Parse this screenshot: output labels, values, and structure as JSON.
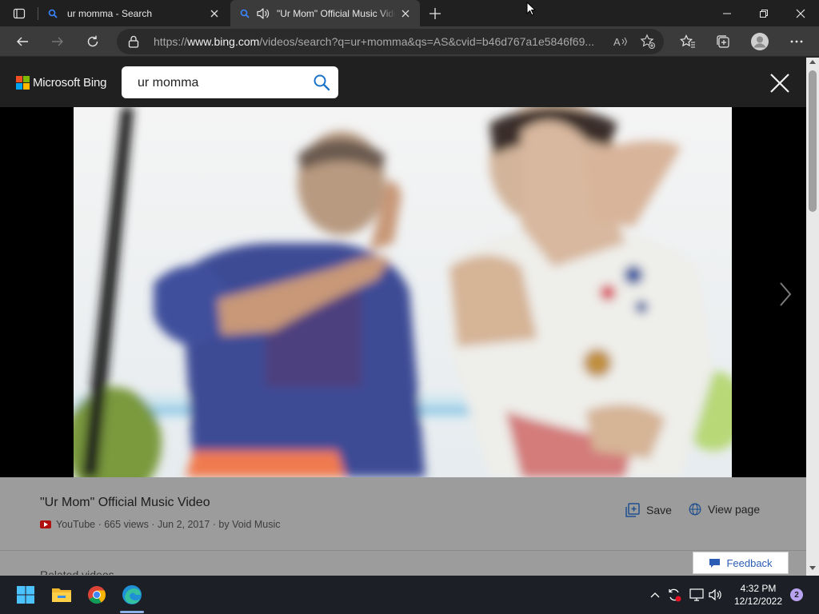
{
  "browser": {
    "tabs": [
      {
        "title": "ur momma - Search",
        "active": false
      },
      {
        "title": "\"Ur Mom\" Official Music Video",
        "active": true,
        "playing_audio": true
      }
    ],
    "url_prefix": "https://",
    "url_host": "www.bing.com",
    "url_rest": "/videos/search?q=ur+momma&qs=AS&cvid=b46d767a1e5846f69..."
  },
  "bing": {
    "logo_text": "Microsoft Bing",
    "logo_colors": [
      "#f25022",
      "#7fba00",
      "#00a4ef",
      "#ffb900"
    ],
    "search_query": "ur momma"
  },
  "video": {
    "title": "\"Ur Mom\" Official Music Video",
    "source": "YouTube",
    "views": "665 views",
    "date": "Jun 2, 2017",
    "channel": "by Void Music",
    "separator": " · ",
    "save_label": "Save",
    "view_page_label": "View page",
    "related_label": "Related videos",
    "feedback_label": "Feedback"
  },
  "taskbar": {
    "time": "4:32 PM",
    "date": "12/12/2022",
    "notification_count": "2",
    "apps": [
      "windows-start-icon",
      "file-explorer-icon",
      "chrome-icon",
      "edge-icon"
    ]
  },
  "colors": {
    "accent_blue": "#2b5db5",
    "panel_gray": "#9c9c9c"
  }
}
